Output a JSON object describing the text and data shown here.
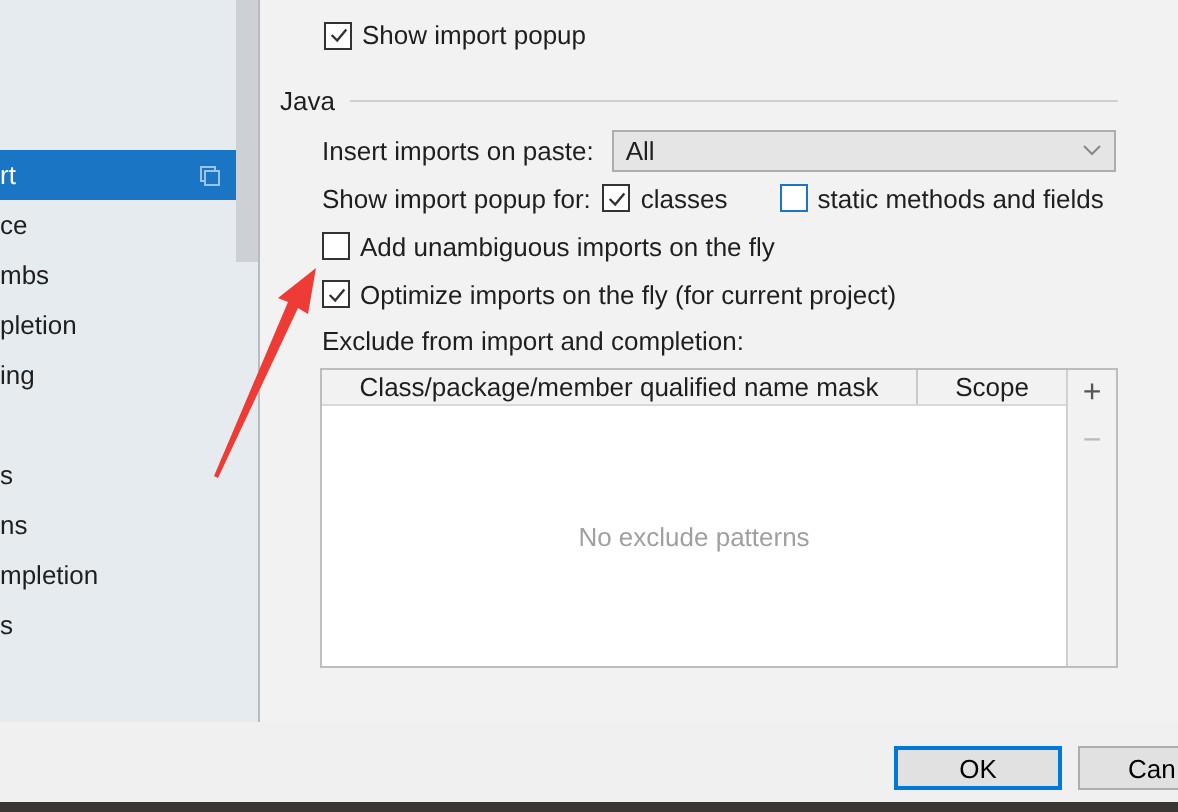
{
  "sidebar": {
    "groups": [
      {
        "items": [
          {
            "label": "rt",
            "selected": true
          },
          {
            "label": "ce",
            "selected": false
          },
          {
            "label": "mbs",
            "selected": false
          },
          {
            "label": "pletion",
            "selected": false
          },
          {
            "label": "ing",
            "selected": false
          }
        ]
      },
      {
        "items": [
          {
            "label": "s",
            "selected": false
          },
          {
            "label": "ns",
            "selected": false
          },
          {
            "label": "mpletion",
            "selected": false
          },
          {
            "label": "s",
            "selected": false
          }
        ]
      }
    ]
  },
  "show_import_popup": {
    "label": "Show import popup",
    "checked": true
  },
  "java": {
    "title": "Java",
    "insert_imports": {
      "label": "Insert imports on paste:",
      "value": "All"
    },
    "popup_for": {
      "label": "Show import popup for:",
      "options": [
        {
          "label": "classes",
          "checked": true
        },
        {
          "label": "static methods and fields",
          "checked": false
        }
      ]
    },
    "options": [
      {
        "label": "Add unambiguous imports on the fly",
        "checked": false
      },
      {
        "label": "Optimize imports on the fly (for current project)",
        "checked": true
      }
    ],
    "exclude": {
      "label": "Exclude from import and completion:",
      "columns": [
        "Class/package/member qualified name mask",
        "Scope"
      ],
      "empty_text": "No exclude patterns",
      "actions": [
        "+",
        "−"
      ]
    }
  },
  "buttons": [
    {
      "label": "OK",
      "selected": true
    },
    {
      "label": "Can",
      "selected": false
    }
  ]
}
